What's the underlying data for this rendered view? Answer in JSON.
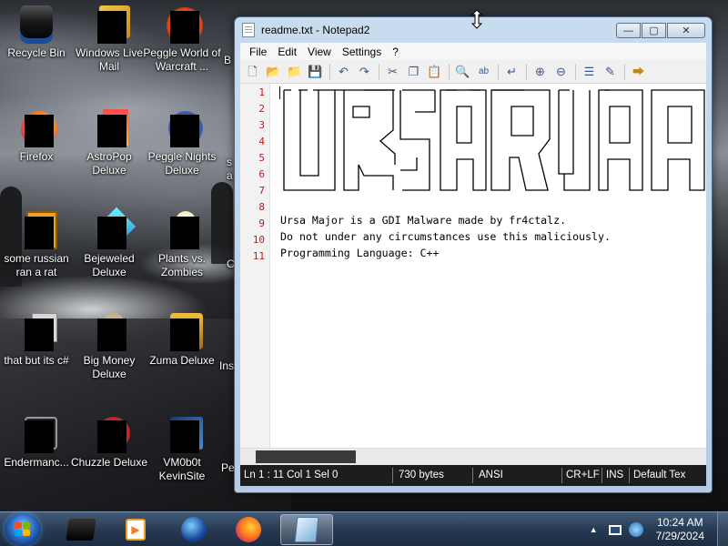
{
  "desktop": {
    "icons": [
      {
        "label": "Recycle Bin"
      },
      {
        "label": "Windows Live Mail"
      },
      {
        "label": "Peggle World of Warcraft ..."
      },
      {
        "label": "Firefox"
      },
      {
        "label": "AstroPop Deluxe"
      },
      {
        "label": "Peggle Nights Deluxe"
      },
      {
        "label": "some russian ran a rat"
      },
      {
        "label": "Bejeweled Deluxe"
      },
      {
        "label": "Plants vs. Zombies"
      },
      {
        "label": "that but its c#"
      },
      {
        "label": "Big Money Deluxe"
      },
      {
        "label": "Zuma Deluxe"
      },
      {
        "label": "Endermanc..."
      },
      {
        "label": "Chuzzle Deluxe"
      },
      {
        "label": "VM0b0t KevinSite"
      }
    ],
    "partial_labels": [
      "B",
      "s",
      "a",
      "C",
      "Ins",
      "Pe"
    ]
  },
  "window": {
    "title": "readme.txt - Notepad2",
    "controls": {
      "minimize": "—",
      "maximize": "▢",
      "close": "✕"
    },
    "menu": [
      "File",
      "Edit",
      "View",
      "Settings",
      "?"
    ],
    "toolbar_icons": [
      "new-icon",
      "open-icon",
      "browse-icon",
      "save-icon",
      "undo-icon",
      "redo-icon",
      "cut-icon",
      "copy-icon",
      "paste-icon",
      "find-icon",
      "replace-icon",
      "word-wrap-icon",
      "zoom-in-icon",
      "zoom-out-icon",
      "view-scheme-icon",
      "customize-scheme-icon",
      "exit-icon"
    ],
    "editor": {
      "line_numbers": [
        "1",
        "2",
        "3",
        "4",
        "5",
        "6",
        "7",
        "8",
        "9",
        "10",
        "11"
      ],
      "lines": [
        "",
        "",
        "",
        "",
        "",
        "",
        "",
        "",
        "Ursa Major is a GDI Malware made by fr4ctalz.",
        "Do not under any circumstances use this maliciously.",
        "Programming Language: C++"
      ]
    },
    "status": {
      "position": "Ln 1 : 11   Col 1   Sel 0",
      "size": "730 bytes",
      "encoding": "ANSI",
      "line_endings": "CR+LF",
      "mode": "INS",
      "scheme": "Default Tex"
    }
  },
  "taskbar": {
    "pinned": [
      "media-icon",
      "media-player-icon",
      "ie-icon",
      "firefox-icon",
      "notepad2-icon"
    ],
    "clock": {
      "time": "10:24 AM",
      "date": "7/29/2024"
    }
  }
}
